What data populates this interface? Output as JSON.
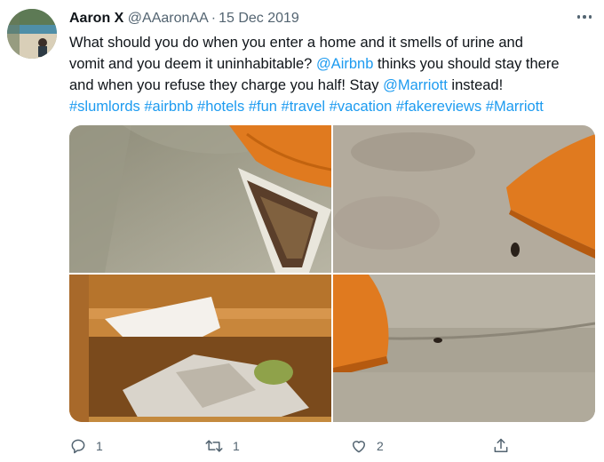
{
  "tweet": {
    "author_name": "Aaron X",
    "author_handle": "@AAaronAA",
    "separator": "·",
    "date": "15 Dec 2019",
    "text_parts": {
      "l1": "What should you do when you enter a home and it smells of urine and",
      "l2_a": "vomit and you deem it uninhabitable? ",
      "l2_mention": "@Airbnb",
      "l2_b": " thinks you should stay there",
      "l3_a": "and when you refuse they charge you half! Stay ",
      "l3_mention": "@Marriott",
      "l3_b": " instead!",
      "hashtags": [
        "#slumlords",
        "#airbnb",
        "#hotels",
        "#fun",
        "#travel",
        "#vacation",
        "#fakereviews",
        "#Marriott"
      ]
    },
    "colors": {
      "link": "#1d9bf0",
      "secondary": "#536471",
      "text": "#0f1419"
    }
  },
  "actions": {
    "reply_count": "1",
    "retweet_count": "1",
    "like_count": "2",
    "icons": [
      "reply-icon",
      "retweet-icon",
      "like-icon",
      "share-icon"
    ]
  },
  "header_icons": [
    "more-icon"
  ]
}
